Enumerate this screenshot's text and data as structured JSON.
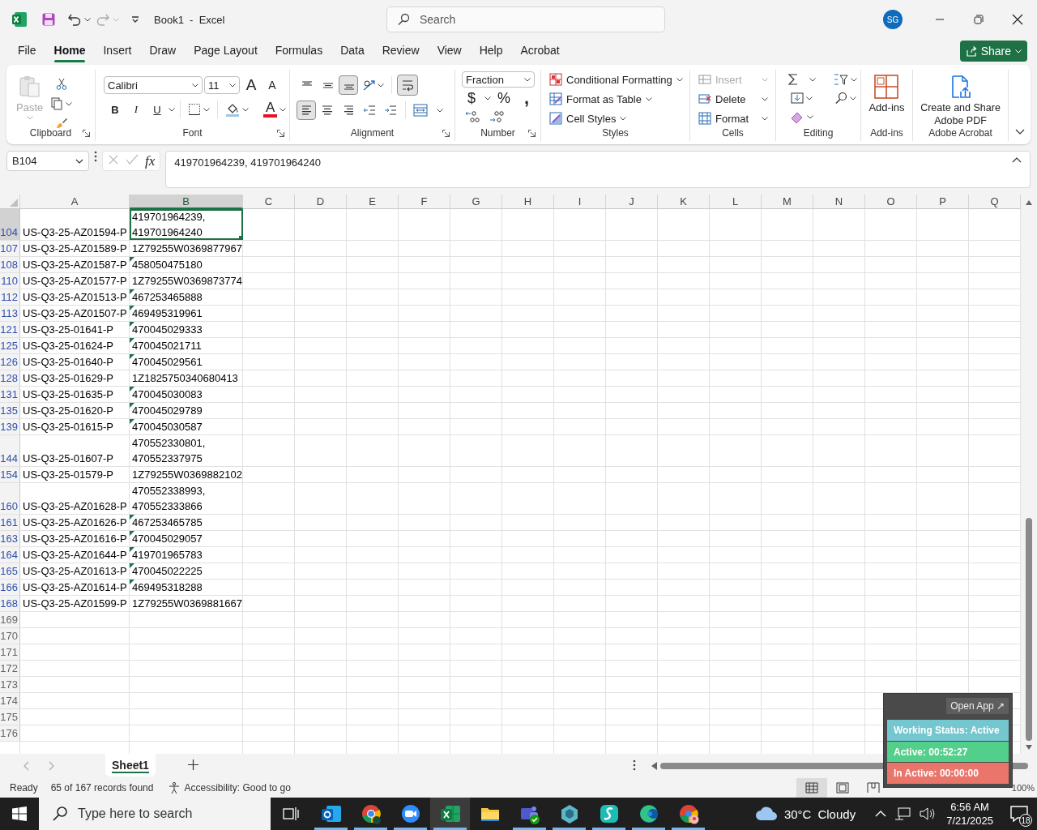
{
  "title_bar": {
    "title": "Book1  -  Excel",
    "search": {
      "placeholder": "Search"
    },
    "avatar": "SG"
  },
  "menu_tabs": [
    {
      "label": "File",
      "selected": false
    },
    {
      "label": "Home",
      "selected": true
    },
    {
      "label": "Insert",
      "selected": false
    },
    {
      "label": "Draw",
      "selected": false
    },
    {
      "label": "Page Layout",
      "selected": false
    },
    {
      "label": "Formulas",
      "selected": false
    },
    {
      "label": "Data",
      "selected": false
    },
    {
      "label": "Review",
      "selected": false
    },
    {
      "label": "View",
      "selected": false
    },
    {
      "label": "Help",
      "selected": false
    },
    {
      "label": "Acrobat",
      "selected": false
    }
  ],
  "share_button": {
    "label": "Share"
  },
  "ribbon": {
    "groups": [
      {
        "kind": "clipboard",
        "label": "Clipboard",
        "paste": {
          "label": "Paste",
          "disabled": true
        }
      },
      {
        "kind": "font",
        "label": "Font",
        "font_name": "Calibri",
        "font_size": "11",
        "grow": "A",
        "shrink": "A",
        "bold": "B",
        "italic": "I",
        "underline": "U",
        "font_color": "A"
      },
      {
        "kind": "alignment",
        "label": "Alignment",
        "vertical": [
          {
            "kind": "top",
            "selected": false
          },
          {
            "kind": "middle",
            "selected": false
          },
          {
            "kind": "bottom",
            "selected": true
          }
        ],
        "horizontal": [
          {
            "kind": "left",
            "selected": true
          },
          {
            "kind": "center",
            "selected": false
          },
          {
            "kind": "right",
            "selected": false
          }
        ],
        "wrap_text": true
      },
      {
        "kind": "number",
        "label": "Number",
        "format": "Fraction",
        "currency": "$",
        "percent": "%",
        "comma": ","
      },
      {
        "kind": "styles",
        "label": "Styles",
        "items": [
          "Conditional Formatting",
          "Format as Table",
          "Cell Styles"
        ]
      },
      {
        "kind": "cells",
        "label": "Cells",
        "items": [
          {
            "label": "Insert",
            "disabled": true
          },
          {
            "label": "Delete",
            "disabled": false
          },
          {
            "label": "Format",
            "disabled": false
          }
        ]
      },
      {
        "kind": "editing",
        "label": "Editing"
      },
      {
        "kind": "addins",
        "label": "Add-ins",
        "button": "Add-ins"
      },
      {
        "kind": "acrobat",
        "label": "Adobe Acrobat",
        "button": "Create and Share Adobe PDF"
      }
    ]
  },
  "formula_bar": {
    "name_box": "B104",
    "fx": "fx",
    "formula": "419701964239, 419701964240"
  },
  "columns": [
    {
      "label": "A",
      "selected": false
    },
    {
      "label": "B",
      "selected": true
    },
    {
      "label": "C",
      "selected": false
    },
    {
      "label": "D",
      "selected": false
    },
    {
      "label": "E",
      "selected": false
    },
    {
      "label": "F",
      "selected": false
    },
    {
      "label": "G",
      "selected": false
    },
    {
      "label": "H",
      "selected": false
    },
    {
      "label": "I",
      "selected": false
    },
    {
      "label": "J",
      "selected": false
    },
    {
      "label": "K",
      "selected": false
    },
    {
      "label": "L",
      "selected": false
    },
    {
      "label": "M",
      "selected": false
    },
    {
      "label": "N",
      "selected": false
    },
    {
      "label": "O",
      "selected": false
    },
    {
      "label": "P",
      "selected": false
    },
    {
      "label": "Q",
      "selected": false
    }
  ],
  "rows": [
    {
      "header": "104",
      "a": "US-Q3-25-AZ01594-P",
      "b": "419701964239, 419701964240",
      "selected": true,
      "filtered": true,
      "flag": false
    },
    {
      "header": "107",
      "a": "US-Q3-25-AZ01589-P",
      "b": "1Z79255W0369877967",
      "selected": false,
      "filtered": true,
      "flag": false
    },
    {
      "header": "108",
      "a": "US-Q3-25-AZ01587-P",
      "b": "458050475180",
      "selected": false,
      "filtered": true,
      "flag": true
    },
    {
      "header": "110",
      "a": "US-Q3-25-AZ01577-P",
      "b": "1Z79255W0369873774",
      "selected": false,
      "filtered": true,
      "flag": false
    },
    {
      "header": "112",
      "a": "US-Q3-25-AZ01513-P",
      "b": "467253465888",
      "selected": false,
      "filtered": true,
      "flag": true
    },
    {
      "header": "113",
      "a": "US-Q3-25-AZ01507-P",
      "b": "469495319961",
      "selected": false,
      "filtered": true,
      "flag": true
    },
    {
      "header": "121",
      "a": "US-Q3-25-01641-P",
      "b": "470045029333",
      "selected": false,
      "filtered": true,
      "flag": true
    },
    {
      "header": "125",
      "a": "US-Q3-25-01624-P",
      "b": "470045021711",
      "selected": false,
      "filtered": true,
      "flag": true
    },
    {
      "header": "126",
      "a": "US-Q3-25-01640-P",
      "b": "470045029561",
      "selected": false,
      "filtered": true,
      "flag": true
    },
    {
      "header": "128",
      "a": "US-Q3-25-01629-P",
      "b": "1Z1825750340680413",
      "selected": false,
      "filtered": true,
      "flag": false
    },
    {
      "header": "131",
      "a": "US-Q3-25-01635-P",
      "b": "470045030083",
      "selected": false,
      "filtered": true,
      "flag": true
    },
    {
      "header": "135",
      "a": "US-Q3-25-01620-P",
      "b": "470045029789",
      "selected": false,
      "filtered": true,
      "flag": true
    },
    {
      "header": "139",
      "a": "US-Q3-25-01615-P",
      "b": "470045030587",
      "selected": false,
      "filtered": true,
      "flag": true
    },
    {
      "header": "144",
      "a": "US-Q3-25-01607-P",
      "b": "470552330801, 470552337975",
      "selected": false,
      "filtered": true,
      "flag": false
    },
    {
      "header": "154",
      "a": "US-Q3-25-01579-P",
      "b": "1Z79255W0369882102",
      "selected": false,
      "filtered": true,
      "flag": false
    },
    {
      "header": "160",
      "a": "US-Q3-25-AZ01628-P",
      "b": "470552338993, 470552333866",
      "selected": false,
      "filtered": true,
      "flag": false
    },
    {
      "header": "161",
      "a": "US-Q3-25-AZ01626-P",
      "b": "467253465785",
      "selected": false,
      "filtered": true,
      "flag": true
    },
    {
      "header": "163",
      "a": "US-Q3-25-AZ01616-P",
      "b": "470045029057",
      "selected": false,
      "filtered": true,
      "flag": true
    },
    {
      "header": "164",
      "a": "US-Q3-25-AZ01644-P",
      "b": "419701965783",
      "selected": false,
      "filtered": true,
      "flag": true
    },
    {
      "header": "165",
      "a": "US-Q3-25-AZ01613-P",
      "b": "470045022225",
      "selected": false,
      "filtered": true,
      "flag": true
    },
    {
      "header": "166",
      "a": "US-Q3-25-AZ01614-P",
      "b": "469495318288",
      "selected": false,
      "filtered": true,
      "flag": true
    },
    {
      "header": "168",
      "a": "US-Q3-25-AZ01599-P",
      "b": "1Z79255W0369881667",
      "selected": false,
      "filtered": true,
      "flag": false
    },
    {
      "header": "169",
      "selected": false,
      "filtered": false,
      "flag": false
    },
    {
      "header": "170",
      "selected": false,
      "filtered": false,
      "flag": false
    },
    {
      "header": "171",
      "selected": false,
      "filtered": false,
      "flag": false
    },
    {
      "header": "172",
      "selected": false,
      "filtered": false,
      "flag": false
    },
    {
      "header": "173",
      "selected": false,
      "filtered": false,
      "flag": false
    },
    {
      "header": "174",
      "selected": false,
      "filtered": false,
      "flag": false
    },
    {
      "header": "175",
      "selected": false,
      "filtered": false,
      "flag": false
    },
    {
      "header": "176",
      "selected": false,
      "filtered": false,
      "flag": false
    }
  ],
  "sheet_tabs": [
    {
      "label": "Sheet1",
      "selected": true
    }
  ],
  "status_bar": {
    "mode": "Ready",
    "records": "65 of 167 records found",
    "accessibility": "Accessibility: Good to go",
    "views": [
      {
        "kind": "normal",
        "selected": true
      },
      {
        "kind": "page_layout",
        "selected": false
      },
      {
        "kind": "page_break",
        "selected": false
      }
    ],
    "zoom": "100%"
  },
  "status_widget": {
    "open_app": "Open App ↗",
    "items": [
      {
        "label": "Working Status: Active",
        "color": "#74c6cf"
      },
      {
        "label": "Active: 00:52:27",
        "color": "#52cf8a"
      },
      {
        "label": "In Active: 00:00:00",
        "color": "#e9756b"
      }
    ]
  },
  "taskbar": {
    "search": {
      "placeholder": "Type here to search"
    },
    "apps": [
      {
        "kind": "outlook",
        "running": true,
        "selected": false
      },
      {
        "kind": "chrome",
        "running": true,
        "selected": false
      },
      {
        "kind": "zoom",
        "running": true,
        "selected": false
      },
      {
        "kind": "excel",
        "running": true,
        "selected": true
      },
      {
        "kind": "explorer",
        "running": false,
        "selected": false
      },
      {
        "kind": "teams",
        "running": true,
        "selected": false
      },
      {
        "kind": "hexapp",
        "running": true,
        "selected": false
      },
      {
        "kind": "surfshark",
        "running": true,
        "selected": false
      },
      {
        "kind": "edge",
        "running": true,
        "selected": false
      },
      {
        "kind": "chrome2",
        "running": true,
        "selected": false
      }
    ],
    "weather": {
      "temp": "30°C",
      "condition": "Cloudy"
    },
    "time": "6:56 AM",
    "date": "7/21/2025",
    "notifications": "18"
  }
}
